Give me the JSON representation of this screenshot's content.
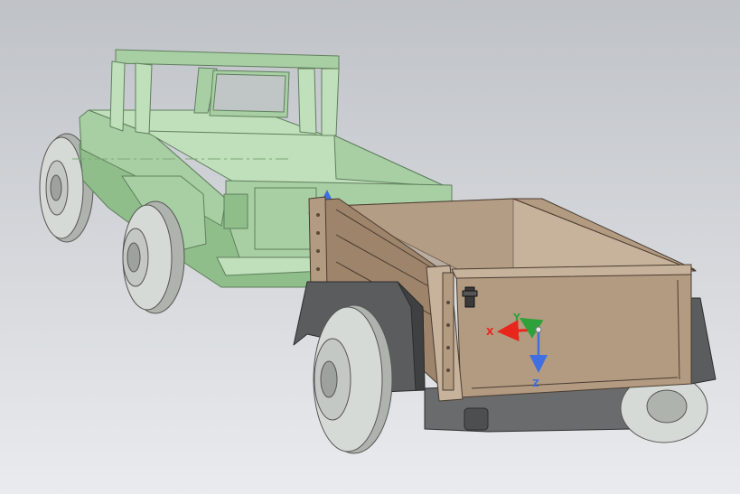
{
  "viewport": {
    "background_top": "#bfc2c7",
    "background_bottom": "#e9ebee"
  },
  "colors": {
    "truck_body": "#a8cfa3",
    "truck_body_shade": "#8fbe8a",
    "truck_body_light": "#c0dfbb",
    "truck_edge": "#5f7f5d",
    "trailer_wood": "#b39b82",
    "trailer_wood_dark": "#9d846b",
    "trailer_wood_light": "#c7b29c",
    "trailer_edge": "#4a3c30",
    "fender": "#5b5c5e",
    "fender_dark": "#3f4042",
    "chassis": "#6a6b6d",
    "tire": "#d6dad6",
    "tire_shade": "#aeb3ae",
    "axis_x": "#e8261c",
    "axis_y": "#2fa13a",
    "axis_z": "#3f6fe0"
  },
  "triad": {
    "x_label": "X",
    "y_label": "Y",
    "z_label": "Z"
  },
  "icons": {
    "coordinate_triad": "coordinate-triad-icon",
    "dragger": "move-dragger-icon"
  }
}
